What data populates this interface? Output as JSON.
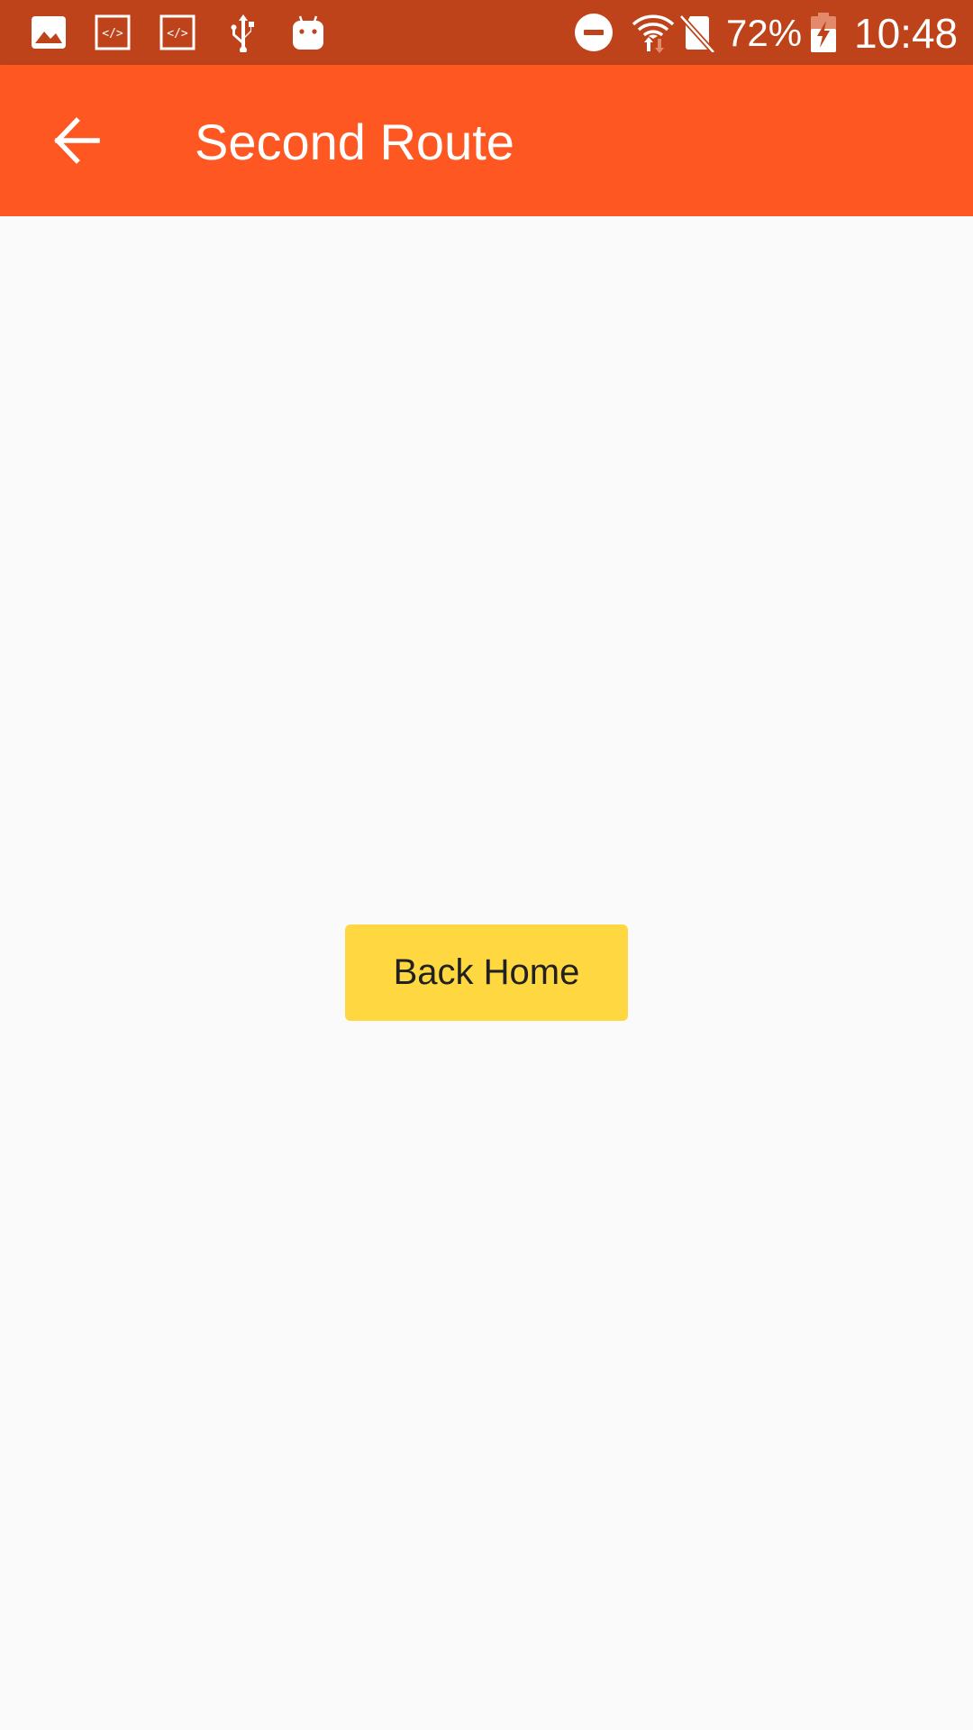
{
  "status_bar": {
    "left_icons": [
      "image-icon",
      "code-icon",
      "code-icon",
      "usb-icon",
      "android-icon"
    ],
    "right_icons": [
      "do-not-disturb-icon",
      "wifi-icon",
      "no-sim-icon",
      "battery-charging-icon"
    ],
    "battery_percent": "72%",
    "time": "10:48"
  },
  "app_bar": {
    "back_icon": "arrow-back-icon",
    "title": "Second Route"
  },
  "main": {
    "button_label": "Back Home"
  },
  "colors": {
    "status_bar": "#bf431a",
    "app_bar": "#ff5722",
    "background": "#fafafa",
    "button": "#ffd740",
    "button_text": "#212121",
    "icon": "#ffffff"
  }
}
